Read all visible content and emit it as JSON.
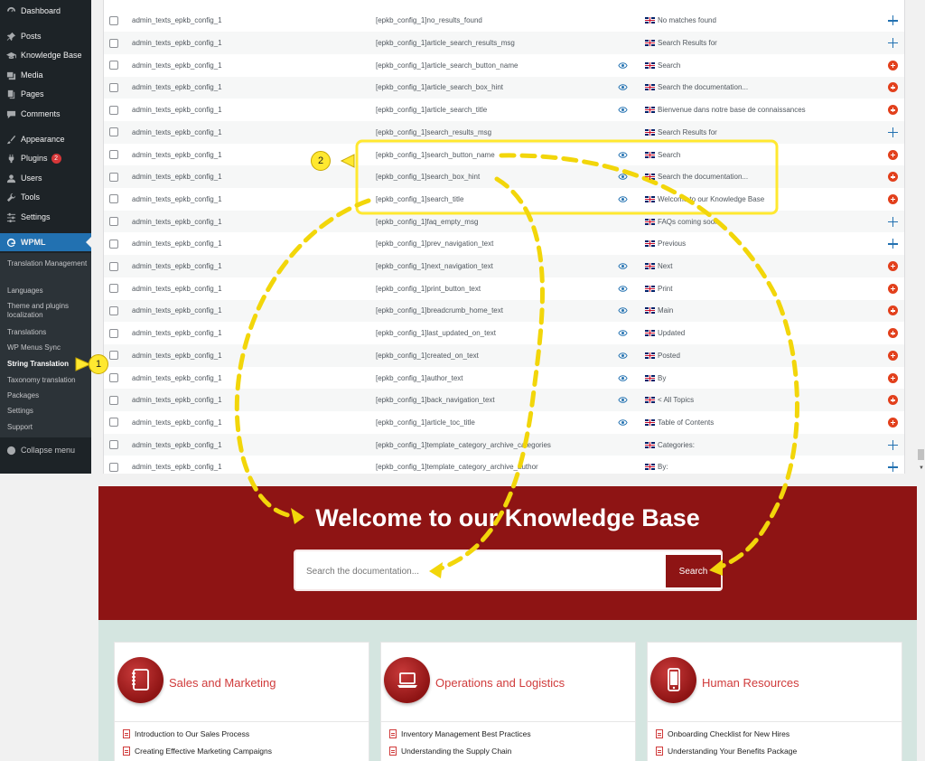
{
  "sidebar": {
    "items": [
      {
        "label": "Dashboard",
        "icon": "dashboard-icon"
      },
      {
        "label": "Posts",
        "icon": "pin-icon"
      },
      {
        "label": "Knowledge Base",
        "icon": "graduation-cap-icon"
      },
      {
        "label": "Media",
        "icon": "media-icon"
      },
      {
        "label": "Pages",
        "icon": "pages-icon"
      },
      {
        "label": "Comments",
        "icon": "comment-icon"
      },
      {
        "label": "Appearance",
        "icon": "brush-icon"
      },
      {
        "label": "Plugins",
        "icon": "plug-icon",
        "badge": "2"
      },
      {
        "label": "Users",
        "icon": "user-icon"
      },
      {
        "label": "Tools",
        "icon": "wrench-icon"
      },
      {
        "label": "Settings",
        "icon": "sliders-icon"
      },
      {
        "label": "WPML",
        "icon": "wpml-icon"
      }
    ],
    "submenu": [
      "Translation Management",
      "Languages",
      "Theme and plugins localization",
      "Translations",
      "WP Menus Sync",
      "String Translation",
      "Taxonomy translation",
      "Packages",
      "Settings",
      "Support"
    ],
    "collapse_label": "Collapse menu"
  },
  "strings_table": {
    "rows": [
      {
        "domain": "admin_texts_epkb_config_1",
        "name": "[epkb_config_1]no_results_found",
        "value": "No matches found",
        "eye": false,
        "action": "plus"
      },
      {
        "domain": "admin_texts_epkb_config_1",
        "name": "[epkb_config_1]article_search_results_msg",
        "value": "Search Results for",
        "eye": false,
        "action": "plus"
      },
      {
        "domain": "admin_texts_epkb_config_1",
        "name": "[epkb_config_1]article_search_button_name",
        "value": "Search",
        "eye": true,
        "action": "pencil"
      },
      {
        "domain": "admin_texts_epkb_config_1",
        "name": "[epkb_config_1]article_search_box_hint",
        "value": "Search the documentation...",
        "eye": true,
        "action": "pencil"
      },
      {
        "domain": "admin_texts_epkb_config_1",
        "name": "[epkb_config_1]article_search_title",
        "value": "Bienvenue dans notre base de connaissances",
        "eye": true,
        "action": "pencil"
      },
      {
        "domain": "admin_texts_epkb_config_1",
        "name": "[epkb_config_1]search_results_msg",
        "value": "Search Results for",
        "eye": false,
        "action": "plus"
      },
      {
        "domain": "admin_texts_epkb_config_1",
        "name": "[epkb_config_1]search_button_name",
        "value": "Search",
        "eye": true,
        "action": "pencil"
      },
      {
        "domain": "admin_texts_epkb_config_1",
        "name": "[epkb_config_1]search_box_hint",
        "value": "Search the documentation...",
        "eye": true,
        "action": "pencil"
      },
      {
        "domain": "admin_texts_epkb_config_1",
        "name": "[epkb_config_1]search_title",
        "value": "Welcome to our Knowledge Base",
        "eye": true,
        "action": "pencil"
      },
      {
        "domain": "admin_texts_epkb_config_1",
        "name": "[epkb_config_1]faq_empty_msg",
        "value": "FAQs coming soon",
        "eye": false,
        "action": "plus"
      },
      {
        "domain": "admin_texts_epkb_config_1",
        "name": "[epkb_config_1]prev_navigation_text",
        "value": "Previous",
        "eye": false,
        "action": "plus"
      },
      {
        "domain": "admin_texts_epkb_config_1",
        "name": "[epkb_config_1]next_navigation_text",
        "value": "Next",
        "eye": true,
        "action": "pencil"
      },
      {
        "domain": "admin_texts_epkb_config_1",
        "name": "[epkb_config_1]print_button_text",
        "value": "Print",
        "eye": true,
        "action": "pencil"
      },
      {
        "domain": "admin_texts_epkb_config_1",
        "name": "[epkb_config_1]breadcrumb_home_text",
        "value": "Main",
        "eye": true,
        "action": "pencil"
      },
      {
        "domain": "admin_texts_epkb_config_1",
        "name": "[epkb_config_1]last_updated_on_text",
        "value": "Updated",
        "eye": true,
        "action": "pencil"
      },
      {
        "domain": "admin_texts_epkb_config_1",
        "name": "[epkb_config_1]created_on_text",
        "value": "Posted",
        "eye": true,
        "action": "pencil"
      },
      {
        "domain": "admin_texts_epkb_config_1",
        "name": "[epkb_config_1]author_text",
        "value": "By",
        "eye": true,
        "action": "pencil"
      },
      {
        "domain": "admin_texts_epkb_config_1",
        "name": "[epkb_config_1]back_navigation_text",
        "value": "< All Topics",
        "eye": true,
        "action": "pencil"
      },
      {
        "domain": "admin_texts_epkb_config_1",
        "name": "[epkb_config_1]article_toc_title",
        "value": "Table of Contents",
        "eye": true,
        "action": "pencil"
      },
      {
        "domain": "admin_texts_epkb_config_1",
        "name": "[epkb_config_1]template_category_archive_categories",
        "value": "Categories:",
        "eye": false,
        "action": "plus"
      },
      {
        "domain": "admin_texts_epkb_config_1",
        "name": "[epkb_config_1]template_category_archive_author",
        "value": "By:",
        "eye": false,
        "action": "plus"
      }
    ]
  },
  "knowledge_base": {
    "title": "Welcome to our Knowledge Base",
    "search_placeholder": "Search the documentation...",
    "search_button": "Search",
    "categories": [
      {
        "title": "Sales and Marketing",
        "icon": "notebook-icon",
        "articles": [
          "Introduction to Our Sales Process",
          "Creating Effective Marketing Campaigns"
        ]
      },
      {
        "title": "Operations and Logistics",
        "icon": "laptop-icon",
        "articles": [
          "Inventory Management Best Practices",
          "Understanding the Supply Chain"
        ]
      },
      {
        "title": "Human Resources",
        "icon": "smartphone-icon",
        "articles": [
          "Onboarding Checklist for New Hires",
          "Understanding Your Benefits Package"
        ]
      }
    ]
  },
  "annotations": {
    "step1": "1",
    "step2": "2"
  },
  "colors": {
    "wp_sidebar": "#1d2327",
    "wpml_accent": "#2271b1",
    "kb_red": "#8e1414",
    "kb_body": "#d4e5e0",
    "highlight": "#ffe830"
  }
}
